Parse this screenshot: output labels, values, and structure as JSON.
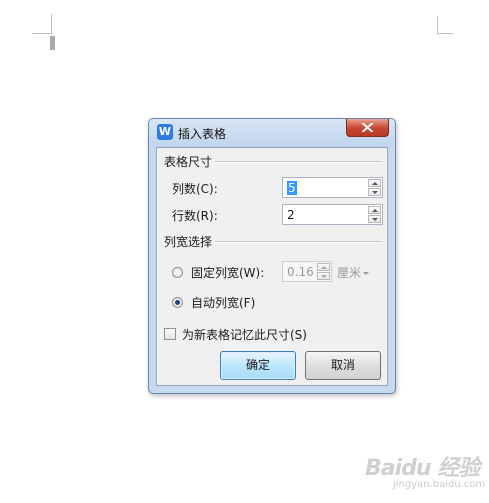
{
  "dialog": {
    "app_icon_glyph": "W",
    "title": "插入表格",
    "close_icon": "close-icon",
    "table_size": {
      "heading": "表格尺寸",
      "columns_label": "列数(C):",
      "columns_value": "5",
      "rows_label": "行数(R):",
      "rows_value": "2"
    },
    "column_width": {
      "heading": "列宽选择",
      "fixed_label": "固定列宽(W):",
      "fixed_value": "0.16",
      "fixed_unit": "厘米",
      "auto_label": "自动列宽(F)",
      "selected": "auto"
    },
    "remember_label": "为新表格记忆此尺寸(S)",
    "remember_checked": false,
    "ok_label": "确定",
    "cancel_label": "取消"
  },
  "watermark": {
    "logo": "Baidu 经验",
    "sub": "jingyan.baidu.com"
  }
}
